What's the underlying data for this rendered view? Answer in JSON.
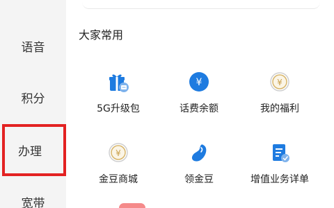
{
  "sidebar": {
    "items": [
      {
        "label": "语音"
      },
      {
        "label": "积分"
      },
      {
        "label": "办理"
      },
      {
        "label": "宽带"
      }
    ]
  },
  "section": {
    "title": "大家常用",
    "services": [
      {
        "label": "5G升级包",
        "icon": "gift-package-icon"
      },
      {
        "label": "话费余额",
        "icon": "yen-coin-icon"
      },
      {
        "label": "我的福利",
        "icon": "yen-coin-outline-icon"
      },
      {
        "label": "金豆商城",
        "icon": "yen-coin-outline-icon"
      },
      {
        "label": "领金豆",
        "icon": "bean-icon"
      },
      {
        "label": "增值业务详单",
        "icon": "document-list-icon"
      }
    ]
  },
  "colors": {
    "accent": "#1e7be0",
    "coin_gold": "#d7b56a",
    "highlight_red": "#e32222",
    "sidebar_bg": "#f4f4f4"
  }
}
